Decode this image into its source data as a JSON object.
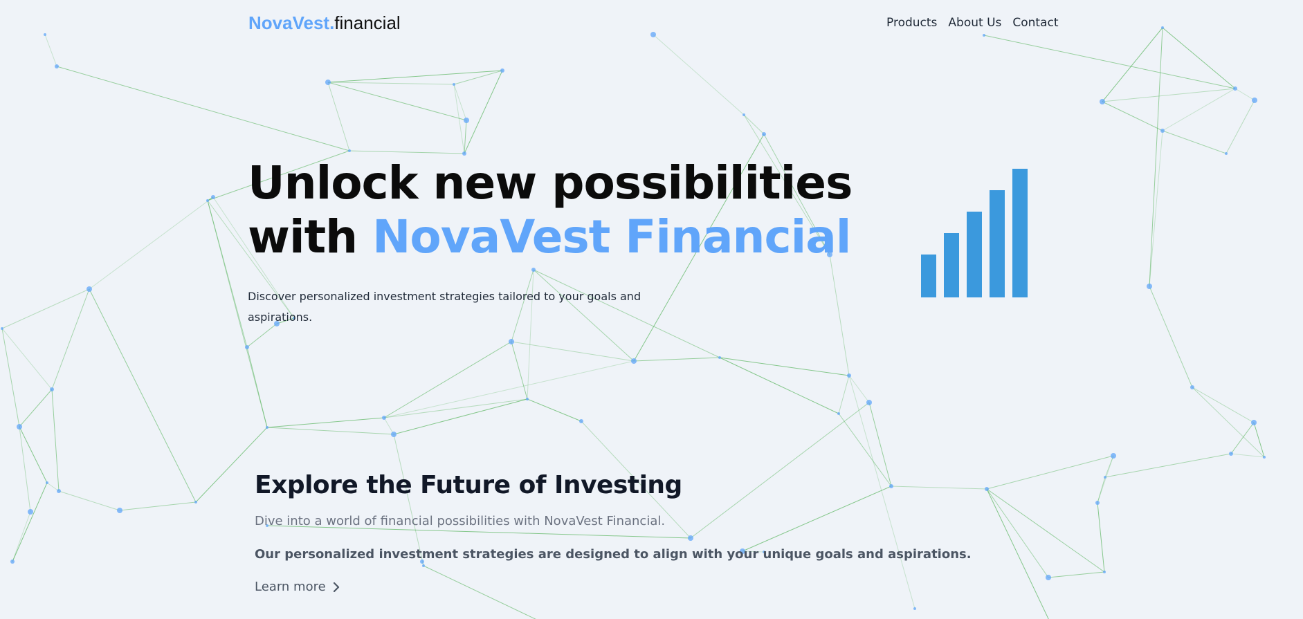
{
  "header": {
    "logo_brand": "NovaVest.",
    "logo_suffix": "financial",
    "nav": [
      {
        "label": "Products"
      },
      {
        "label": "About Us"
      },
      {
        "label": "Contact"
      }
    ]
  },
  "hero": {
    "title_line1": "Unlock new possibilities",
    "title_line2_prefix": "with ",
    "title_line2_accent": "NovaVest Financial",
    "subtitle": "Discover personalized investment strategies tailored to your goals and aspirations.",
    "bar_icon": "bar-chart-icon"
  },
  "section": {
    "title": "Explore the Future of Investing",
    "paragraph1": "Dive into a world of financial possibilities with NovaVest Financial.",
    "paragraph2": "Our personalized investment strategies are designed to align with your unique goals and aspirations.",
    "learn_more": "Learn more",
    "learn_more_icon": "chevron-right-icon"
  },
  "colors": {
    "accent": "#60a5fa",
    "bar": "#3b99dd",
    "network_line": "#4caf50",
    "network_node": "#60a5fa",
    "background": "#eff3f8"
  }
}
